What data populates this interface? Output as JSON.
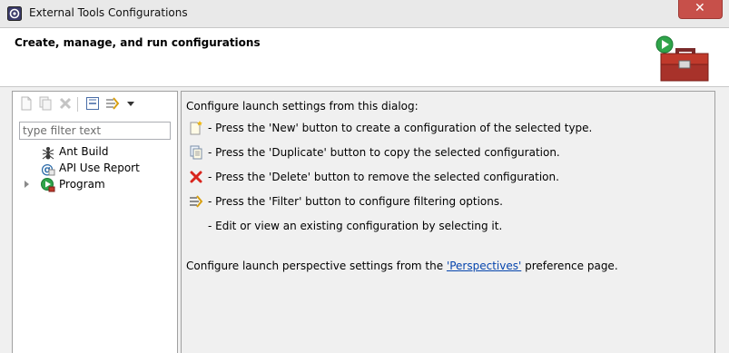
{
  "window": {
    "title": "External Tools Configurations",
    "close_label": "✕"
  },
  "header": {
    "title": "Create, manage, and run configurations",
    "icon": "toolbox-run-icon"
  },
  "left_toolbar": {
    "icons": [
      "new-configuration-icon",
      "duplicate-icon",
      "delete-icon",
      "collapse-all-icon",
      "filter-icon",
      "view-menu-dropdown-icon"
    ]
  },
  "filter": {
    "placeholder": "type filter text",
    "value": ""
  },
  "tree": {
    "items": [
      {
        "label": "Ant Build",
        "icon": "ant-icon",
        "expandable": false
      },
      {
        "label": "API Use Report",
        "icon": "api-report-icon",
        "expandable": false
      },
      {
        "label": "Program",
        "icon": "program-run-icon",
        "expandable": true
      }
    ]
  },
  "main": {
    "heading": "Configure launch settings from this dialog:",
    "rows": [
      {
        "icon": "new-icon",
        "text": "- Press the 'New' button to create a configuration of the selected type."
      },
      {
        "icon": "duplicate-icon",
        "text": "- Press the 'Duplicate' button to copy the selected configuration."
      },
      {
        "icon": "delete-icon",
        "text": "- Press the 'Delete' button to remove the selected configuration."
      },
      {
        "icon": "filter-icon",
        "text": "- Press the 'Filter' button to configure filtering options."
      },
      {
        "icon": "",
        "text": "- Edit or view an existing configuration by selecting it."
      }
    ],
    "footer_before": "Configure launch perspective settings from the ",
    "footer_link": "'Perspectives'",
    "footer_after": " preference page."
  },
  "colors": {
    "link": "#0645ad",
    "close_button": "#c7504a",
    "delete_icon": "#d9251d"
  }
}
